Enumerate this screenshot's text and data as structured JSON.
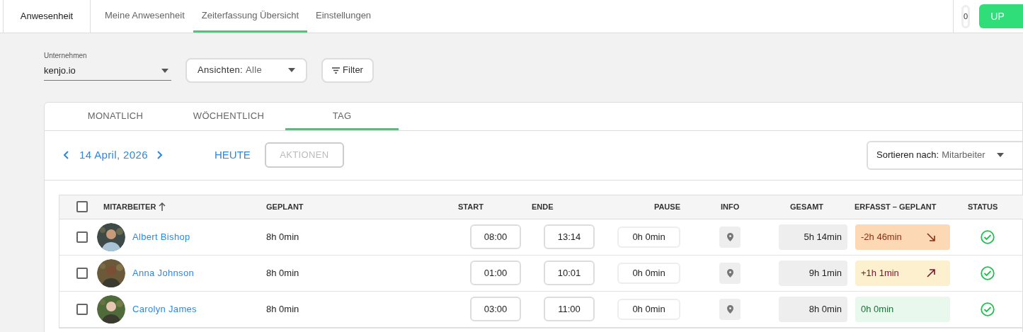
{
  "header": {
    "title": "Anwesenheit",
    "tabs": [
      {
        "label": "Meine Anwesenheit",
        "selected": false
      },
      {
        "label": "Zeiterfassung Übersicht",
        "selected": true
      },
      {
        "label": "Einstellungen",
        "selected": false
      }
    ],
    "counter": "0",
    "upgrade_button": "UP"
  },
  "filters": {
    "company": {
      "label": "Unternehmen",
      "value": "kenjo.io"
    },
    "views": {
      "label": "Ansichten:",
      "value": "Alle"
    },
    "filter_button": "Filter"
  },
  "period_tabs": [
    {
      "label": "MONATLICH",
      "selected": false
    },
    {
      "label": "WÖCHENTLICH",
      "selected": false
    },
    {
      "label": "TAG",
      "selected": true
    }
  ],
  "toolbar": {
    "date": "14 April, 2026",
    "today": "HEUTE",
    "actions": {
      "label": "AKTIONEN",
      "disabled": true
    },
    "sort": {
      "label": "Sortieren nach:",
      "value": "Mitarbeiter"
    }
  },
  "table": {
    "columns": [
      "MITARBEITER",
      "GEPLANT",
      "START",
      "ENDE",
      "PAUSE",
      "INFO",
      "GESAMT",
      "ERFASST – GEPLANT",
      "STATUS"
    ],
    "select_all_checked": false,
    "rows": [
      {
        "checked": false,
        "name": "Albert Bishop",
        "planned": "8h 0min",
        "start": "08:00",
        "end": "13:14",
        "pause": "0h 0min",
        "total": "5h 14min",
        "diff": {
          "kind": "negative",
          "text": "-2h 46min"
        },
        "approved": true
      },
      {
        "checked": false,
        "name": "Anna Johnson",
        "planned": "8h 0min",
        "start": "01:00",
        "end": "10:01",
        "pause": "0h 0min",
        "total": "9h 1min",
        "diff": {
          "kind": "positive",
          "text": "+1h 1min"
        },
        "approved": true
      },
      {
        "checked": false,
        "name": "Carolyn James",
        "planned": "8h 0min",
        "start": "03:00",
        "end": "11:00",
        "pause": "0h 0min",
        "total": "8h 0min",
        "diff": {
          "kind": "zero",
          "text": "0h 0min"
        },
        "approved": true
      }
    ]
  }
}
